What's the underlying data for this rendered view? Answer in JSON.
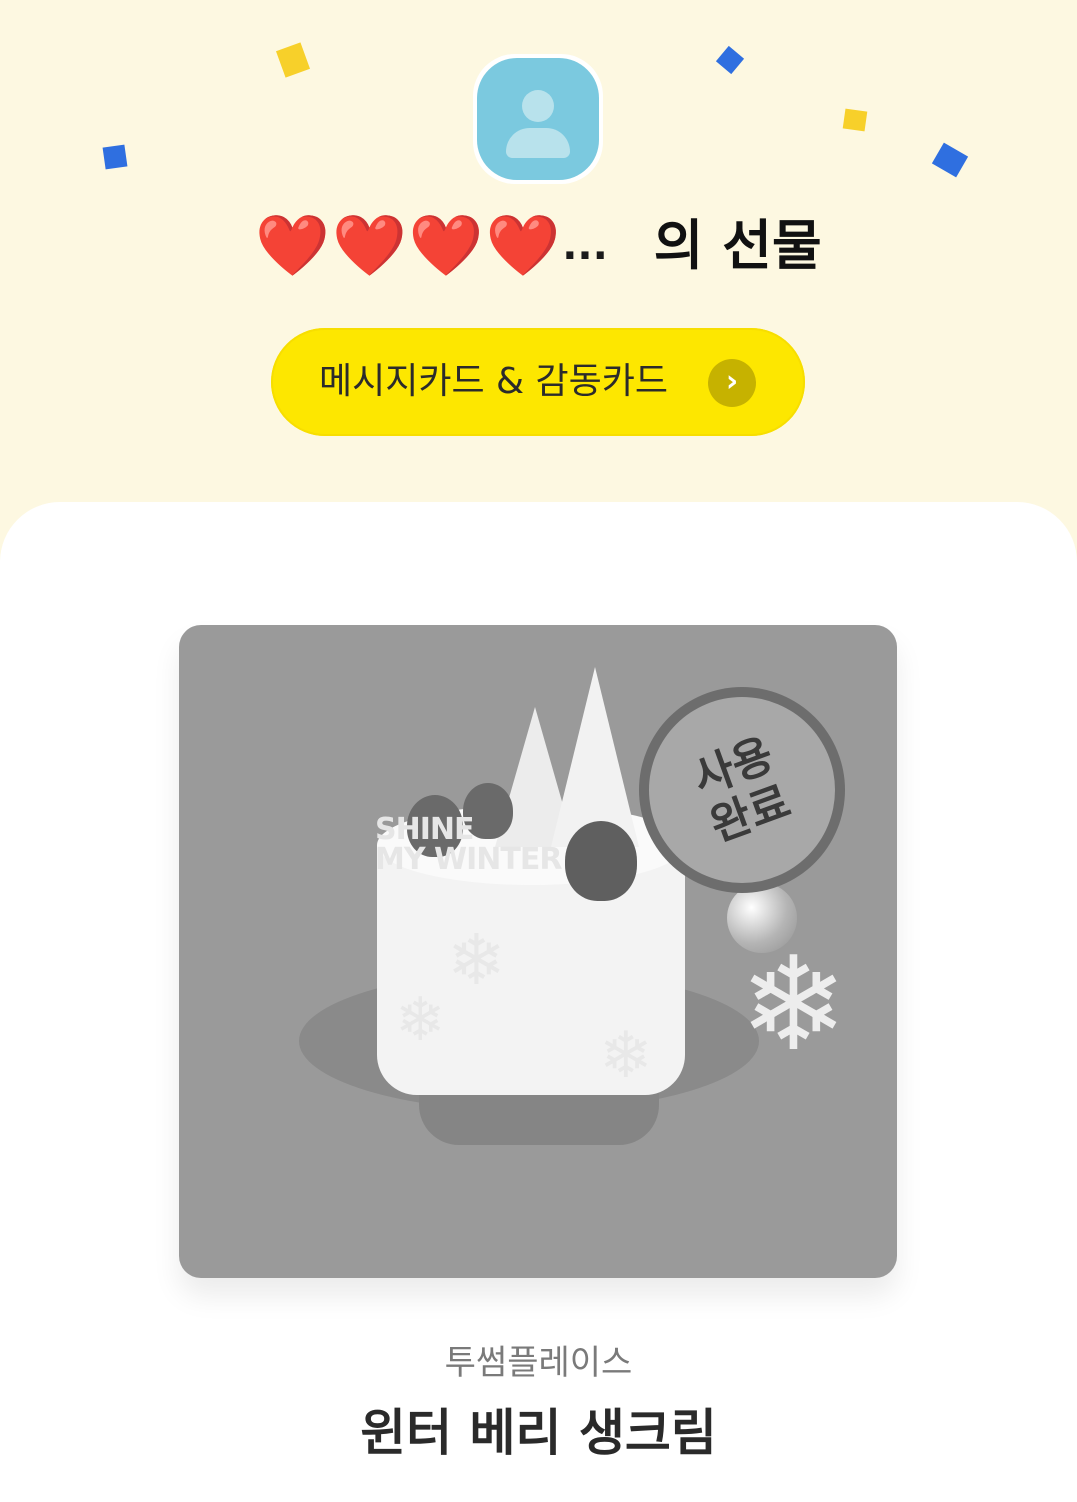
{
  "header": {
    "sender_name": "❤️❤️❤️❤️",
    "sender_ellipsis": "...",
    "gift_suffix": "의 선물"
  },
  "message_button": {
    "label": "메시지카드 & 감동카드",
    "arrow_icon": "chevron-right-icon"
  },
  "product": {
    "stamp_line1": "사용",
    "stamp_line2": "완료",
    "image_text_line1": "SHINE",
    "image_text_line2": "MY WINTER",
    "brand": "투썸플레이스",
    "name": "윈터 베리 생크림"
  },
  "colors": {
    "background": "#fdf8e1",
    "button": "#fde700",
    "confetti_yellow": "#f7d02a",
    "confetti_blue": "#2f6fe0",
    "avatar": "#7bc9df",
    "heart": "#ff2f5b"
  }
}
